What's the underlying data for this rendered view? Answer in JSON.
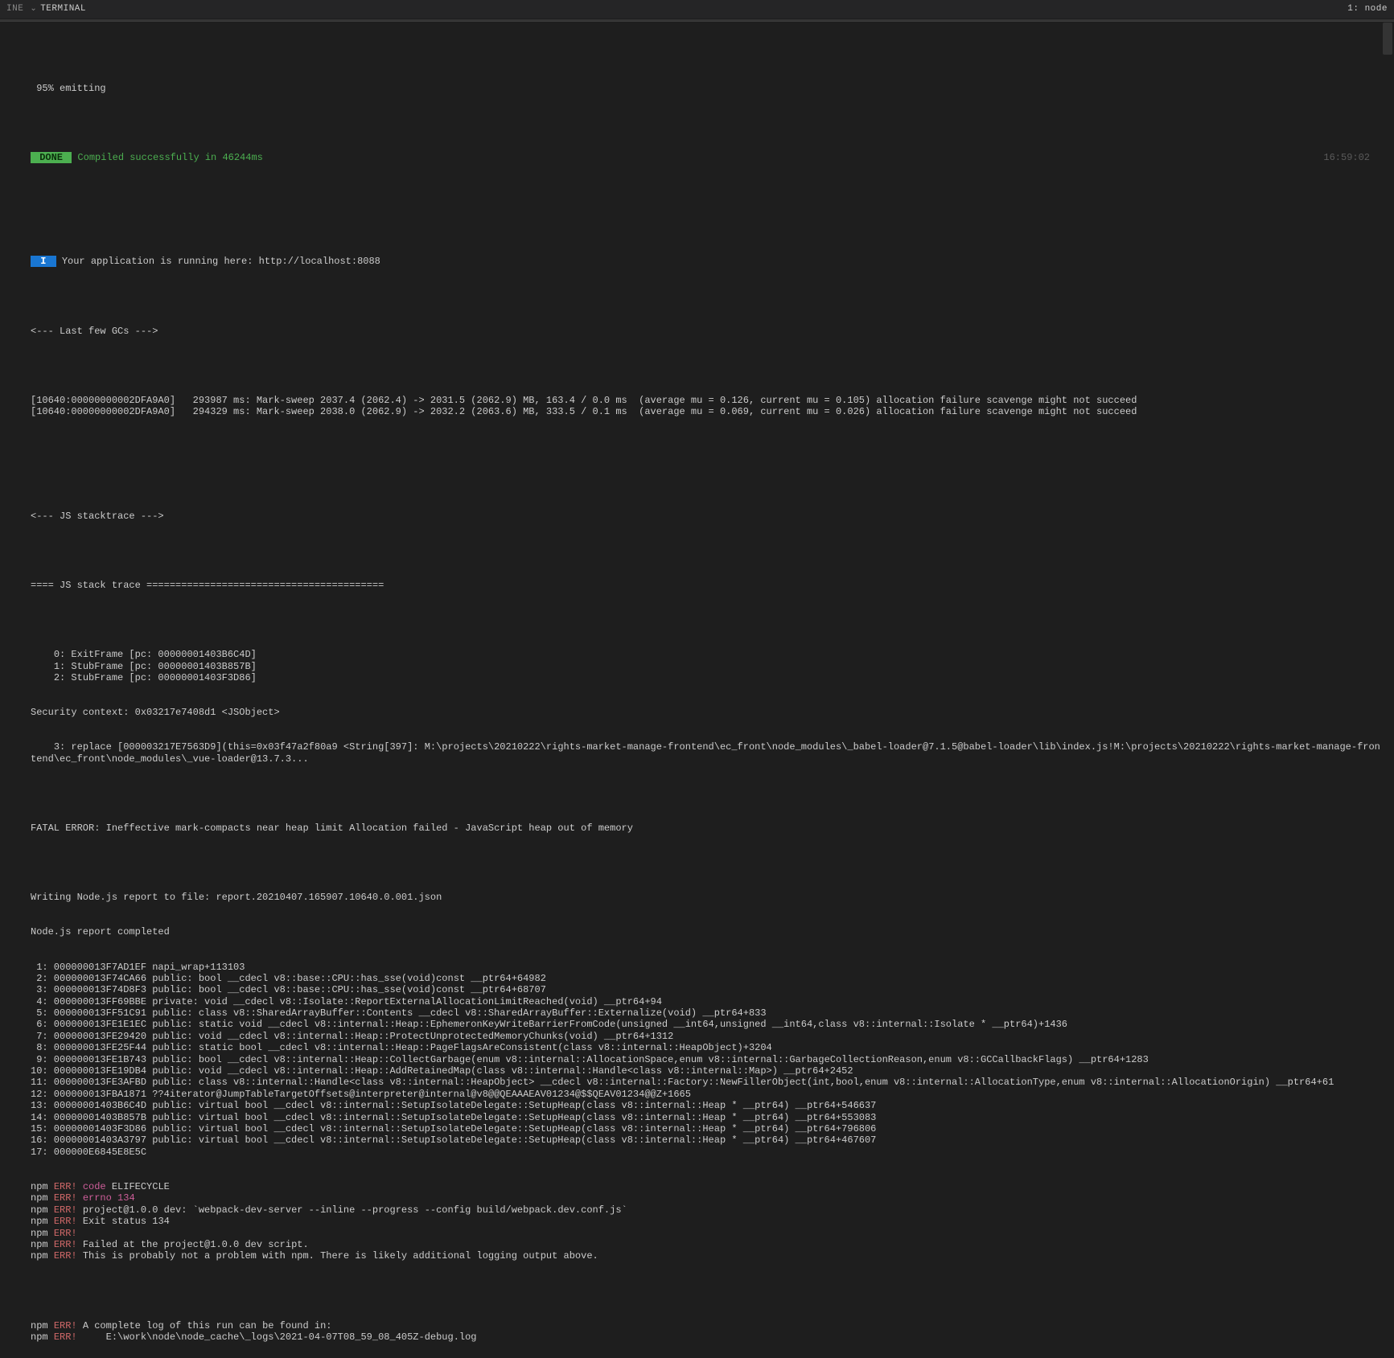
{
  "header": {
    "left_partial_tab": "INE",
    "active_tab": "TERMINAL",
    "right_label": "1: node"
  },
  "timestamp": "16:59:02",
  "progress_line": " 95% emitting",
  "done_label": " DONE ",
  "done_msg": "Compiled successfully in 46244ms",
  "info_label": " I ",
  "info_msg": "Your application is running here: http://localhost:8088",
  "gc_header": "<--- Last few GCs --->",
  "gc_lines": [
    "[10640:00000000002DFA9A0]   293987 ms: Mark-sweep 2037.4 (2062.4) -> 2031.5 (2062.9) MB, 163.4 / 0.0 ms  (average mu = 0.126, current mu = 0.105) allocation failure scavenge might not succeed",
    "[10640:00000000002DFA9A0]   294329 ms: Mark-sweep 2038.0 (2062.9) -> 2032.2 (2063.6) MB, 333.5 / 0.1 ms  (average mu = 0.069, current mu = 0.026) allocation failure scavenge might not succeed"
  ],
  "stacktrace_header": "<--- JS stacktrace --->",
  "stack_title": "==== JS stack trace =========================================",
  "stack_frames": [
    "    0: ExitFrame [pc: 00000001403B6C4D]",
    "    1: StubFrame [pc: 00000001403B857B]",
    "    2: StubFrame [pc: 00000001403F3D86]"
  ],
  "security_context": "Security context: 0x03217e7408d1 <JSObject>",
  "replace_line": "    3: replace [000003217E7563D9](this=0x03f47a2f80a9 <String[397]: M:\\projects\\20210222\\rights-market-manage-frontend\\ec_front\\node_modules\\_babel-loader@7.1.5@babel-loader\\lib\\index.js!M:\\projects\\20210222\\rights-market-manage-frontend\\ec_front\\node_modules\\_vue-loader@13.7.3...",
  "fatal_error": "FATAL ERROR: Ineffective mark-compacts near heap limit Allocation failed - JavaScript heap out of memory",
  "report_writing": "Writing Node.js report to file: report.20210407.165907.10640.0.001.json",
  "report_done": "Node.js report completed",
  "native_stack": [
    " 1: 000000013F7AD1EF napi_wrap+113103",
    " 2: 000000013F74CA66 public: bool __cdecl v8::base::CPU::has_sse(void)const __ptr64+64982",
    " 3: 000000013F74D8F3 public: bool __cdecl v8::base::CPU::has_sse(void)const __ptr64+68707",
    " 4: 000000013FF69BBE private: void __cdecl v8::Isolate::ReportExternalAllocationLimitReached(void) __ptr64+94",
    " 5: 000000013FF51C91 public: class v8::SharedArrayBuffer::Contents __cdecl v8::SharedArrayBuffer::Externalize(void) __ptr64+833",
    " 6: 000000013FE1E1EC public: static void __cdecl v8::internal::Heap::EphemeronKeyWriteBarrierFromCode(unsigned __int64,unsigned __int64,class v8::internal::Isolate * __ptr64)+1436",
    " 7: 000000013FE29420 public: void __cdecl v8::internal::Heap::ProtectUnprotectedMemoryChunks(void) __ptr64+1312",
    " 8: 000000013FE25F44 public: static bool __cdecl v8::internal::Heap::PageFlagsAreConsistent(class v8::internal::HeapObject)+3204",
    " 9: 000000013FE1B743 public: bool __cdecl v8::internal::Heap::CollectGarbage(enum v8::internal::AllocationSpace,enum v8::internal::GarbageCollectionReason,enum v8::GCCallbackFlags) __ptr64+1283",
    "10: 000000013FE19DB4 public: void __cdecl v8::internal::Heap::AddRetainedMap(class v8::internal::Handle<class v8::internal::Map>) __ptr64+2452",
    "11: 000000013FE3AFBD public: class v8::internal::Handle<class v8::internal::HeapObject> __cdecl v8::internal::Factory::NewFillerObject(int,bool,enum v8::internal::AllocationType,enum v8::internal::AllocationOrigin) __ptr64+61",
    "12: 000000013FBA1871 ??4iterator@JumpTableTargetOffsets@interpreter@internal@v8@@QEAAAEAV01234@$$QEAV01234@@Z+1665",
    "13: 00000001403B6C4D public: virtual bool __cdecl v8::internal::SetupIsolateDelegate::SetupHeap(class v8::internal::Heap * __ptr64) __ptr64+546637",
    "14: 00000001403B857B public: virtual bool __cdecl v8::internal::SetupIsolateDelegate::SetupHeap(class v8::internal::Heap * __ptr64) __ptr64+553083",
    "15: 00000001403F3D86 public: virtual bool __cdecl v8::internal::SetupIsolateDelegate::SetupHeap(class v8::internal::Heap * __ptr64) __ptr64+796806",
    "16: 00000001403A3797 public: virtual bool __cdecl v8::internal::SetupIsolateDelegate::SetupHeap(class v8::internal::Heap * __ptr64) __ptr64+467607",
    "17: 000000E6845E8E5C"
  ],
  "npm_err_lines": [
    {
      "rest": "code ELIFECYCLE"
    },
    {
      "rest": "errno 134",
      "mag_rest": true
    },
    {
      "rest": "project@1.0.0 dev: `webpack-dev-server --inline --progress --config build/webpack.dev.conf.js`"
    },
    {
      "rest": "Exit status 134"
    },
    {
      "rest": ""
    },
    {
      "rest": "Failed at the project@1.0.0 dev script."
    },
    {
      "rest": "This is probably not a problem with npm. There is likely additional logging output above."
    }
  ],
  "npm_err_tail": [
    {
      "rest": "A complete log of this run can be found in:"
    },
    {
      "rest": "    E:\\work\\node\\node_cache\\_logs\\2021-04-07T08_59_08_405Z-debug.log"
    }
  ],
  "npm_prefix": "npm",
  "npm_err": "ERR!",
  "npm_code_key": "code",
  "npm_errno_key": "errno"
}
